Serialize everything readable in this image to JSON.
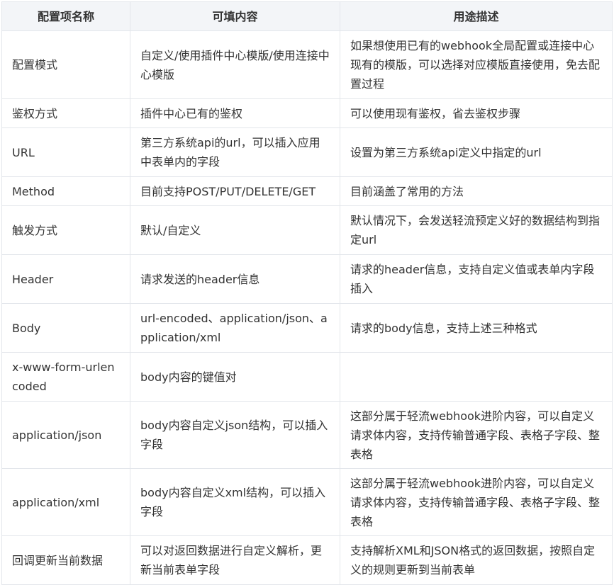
{
  "table": {
    "headers": [
      "配置项名称",
      "可填内容",
      "用途描述"
    ],
    "rows": [
      [
        "配置模式",
        "自定义/使用插件中心模版/使用连接中心模版",
        "如果想使用已有的webhook全局配置或连接中心现有的模版，可以选择对应模版直接使用，免去配置过程"
      ],
      [
        "鉴权方式",
        "插件中心已有的鉴权",
        "可以使用现有鉴权，省去鉴权步骤"
      ],
      [
        "URL",
        "第三方系统api的url，可以插入应用中表单内的字段",
        "设置为第三方系统api定义中指定的url"
      ],
      [
        "Method",
        "目前支持POST/PUT/DELETE/GET",
        "目前涵盖了常用的方法"
      ],
      [
        "触发方式",
        "默认/自定义",
        "默认情况下，会发送轻流预定义好的数据结构到指定url"
      ],
      [
        "Header",
        "请求发送的header信息",
        "请求的header信息，支持自定义值或表单内字段插入"
      ],
      [
        "Body",
        "url-encoded、application/json、application/xml",
        "请求的body信息，支持上述三种格式"
      ],
      [
        "x-www-form-urlencoded",
        "body内容的键值对",
        ""
      ],
      [
        "application/json",
        "body内容自定义json结构，可以插入字段",
        "这部分属于轻流webhook进阶内容，可以自定义请求体内容，支持传输普通字段、表格子字段、整表格"
      ],
      [
        "application/xml",
        "body内容自定义xml结构，可以插入字段",
        "这部分属于轻流webhook进阶内容，可以自定义请求体内容，支持传输普通字段、表格子字段、整表格"
      ],
      [
        "回调更新当前数据",
        "可以对返回数据进行自定义解析，更新当前表单字段",
        "支持解析XML和JSON格式的返回数据，按照自定义的规则更新到当前表单"
      ]
    ]
  }
}
